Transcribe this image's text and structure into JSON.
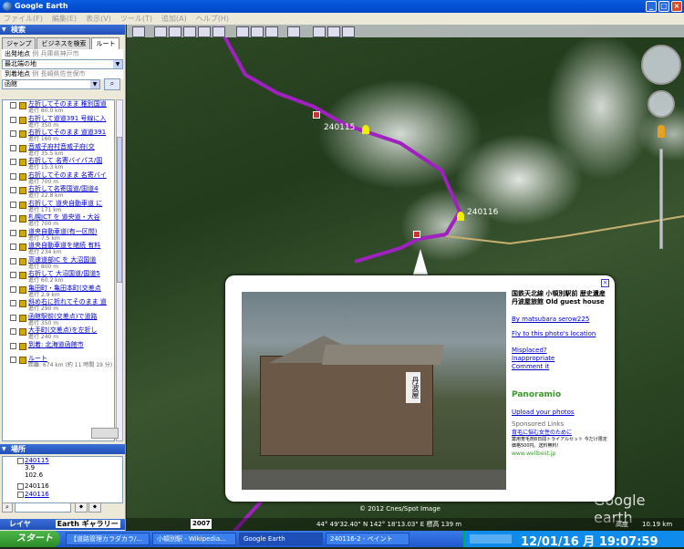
{
  "window": {
    "title": "Google Earth"
  },
  "menu": [
    "ファイル(F)",
    "編集(E)",
    "表示(V)",
    "ツール(T)",
    "追加(A)",
    "ヘルプ(H)"
  ],
  "search": {
    "header": "検索",
    "tabs": [
      "ジャンプ",
      "ビジネスを検索",
      "ルート"
    ],
    "from_label": "出発地点",
    "from_placeholder": "例 兵庫県神戸市",
    "from_value": "最北端の地",
    "to_label": "到着地点",
    "to_placeholder": "例 長崎県佐世保市",
    "to_value": "函館"
  },
  "route_steps": [
    {
      "text": "左折してそのまま 稚別国道",
      "dist": "進行 80.0 km"
    },
    {
      "text": "右折して道道391 号線に入",
      "dist": "進行 350 m"
    },
    {
      "text": "右折してそのまま 道道391",
      "dist": "進行 160 m"
    },
    {
      "text": "音威子府村音威子府(交",
      "dist": "進行 35.5 km"
    },
    {
      "text": "右折して 名寄バイパス/国",
      "dist": "進行 15.3 km"
    },
    {
      "text": "右折してそのまま 名寄バイ",
      "dist": "進行 700 m"
    },
    {
      "text": "右折して名寄国道/国道4",
      "dist": "進行 22.8 km"
    },
    {
      "text": "右折して 道央自動車道 に",
      "dist": "進行 171 km"
    },
    {
      "text": "札幌JCT を 道央道・大谷",
      "dist": "進行 700 m"
    },
    {
      "text": "道央自動車道(有一区間)",
      "dist": "進行 7.5 km"
    },
    {
      "text": "道央自動車道を継続 有料",
      "dist": "進行 234 km"
    },
    {
      "text": "高速道部IC を 大沼国道",
      "dist": "進行 800 m"
    },
    {
      "text": "右折して 大沼国道/国道5",
      "dist": "進行 60.2 km"
    },
    {
      "text": "亀田町・亀田本町(交差点",
      "dist": "進行 2.9 km"
    },
    {
      "text": "斜め右に折れてそのまま 道",
      "dist": "進行 290 m"
    },
    {
      "text": "函館駅前(交差点)で道路",
      "dist": "進行 350 m"
    },
    {
      "text": "大手町(交差点)を左折し",
      "dist": "進行 240 m"
    },
    {
      "text": "到着: 北海道函館市",
      "dist": ""
    },
    {
      "text": "ルート",
      "dist": "距離: 674 km (約 11 時間 19 分)"
    }
  ],
  "places": {
    "header": "場所",
    "items": [
      {
        "label": "240115",
        "sub1": "3.9",
        "sub2": "102.6"
      },
      {
        "label": "240116",
        "sub1": "",
        "sub2": ""
      },
      {
        "label": "240116",
        "sub1": "",
        "sub2": ""
      }
    ]
  },
  "layers": {
    "label": "レイヤ",
    "gallery": "Earth ギャラリー"
  },
  "map": {
    "placemark1": "240115",
    "placemark2": "240116",
    "copyright": "© 2012 Cnes/Spot Image",
    "coords": "44° 49'32.40\" N 142° 18'13.03\" E 標高 139 m",
    "alt_label": "高度",
    "alt_value": "10.19 km",
    "year": "2007",
    "brand": "Google earth"
  },
  "popup": {
    "title": "国鉄天北線 小頓別駅前 歴史遺産 丹波屋旅館 Old guest house",
    "author": "By matsubara serow225",
    "fly": "Fly to this photo's location",
    "misplaced": "Misplaced?",
    "inappropriate": "Inappropriate",
    "comment": "Comment it",
    "panoramio": "Panoramio",
    "upload": "Upload your photos",
    "sponsored": "Sponsored Links",
    "ad_title": "育毛に悩む女性のために",
    "ad_body": "薬用育毛剤8日間トライアルセット 今だけ限定価格500円。送料無料!",
    "ad_url": "www.wellbest.jp",
    "sign": "丹波屋"
  },
  "taskbar": {
    "start": "スタート",
    "tasks": [
      "【道路管理カラダカラ/...",
      "小頓別駅 - Wikipedia...",
      "Google Earth",
      "240116-2 - ペイント"
    ],
    "clock": "12/01/16 月 19:07:59"
  }
}
